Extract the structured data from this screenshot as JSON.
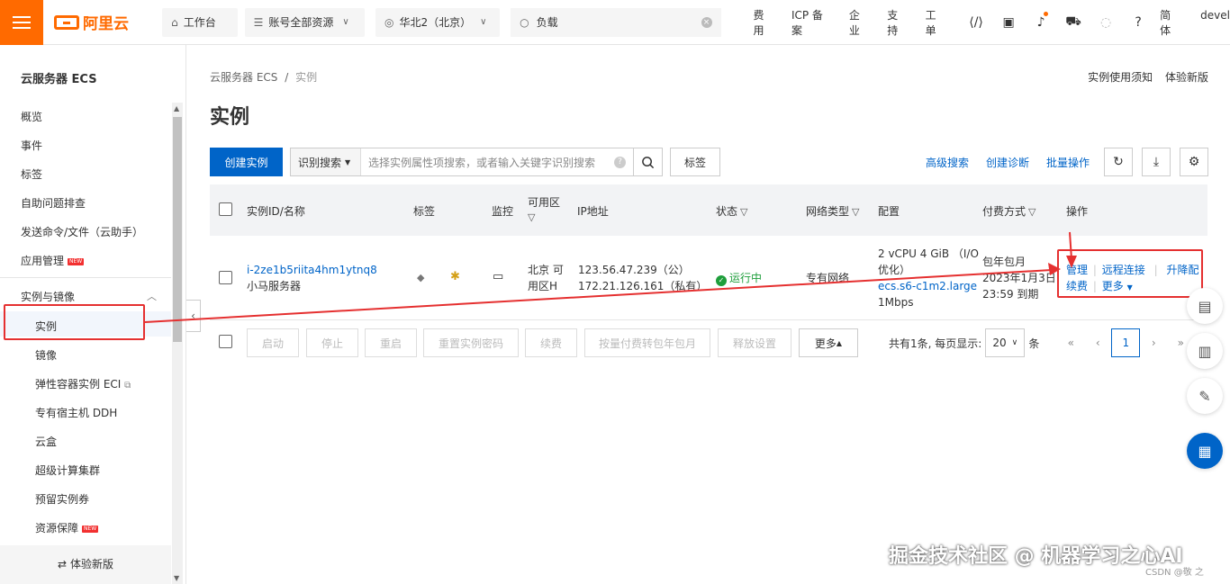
{
  "topbar": {
    "brand": "阿里云",
    "workbench": "工作台",
    "resource_group": "账号全部资源",
    "region": "华北2（北京）",
    "search_value": "负载",
    "links": [
      "费用",
      "ICP 备案",
      "企业",
      "支持",
      "工单"
    ],
    "lang": "简体",
    "user": "devel"
  },
  "sidebar": {
    "title": "云服务器 ECS",
    "items": [
      {
        "label": "概览"
      },
      {
        "label": "事件"
      },
      {
        "label": "标签"
      },
      {
        "label": "自助问题排查"
      },
      {
        "label": "发送命令/文件（云助手）"
      },
      {
        "label": "应用管理",
        "badge": "NEW"
      }
    ],
    "group": "实例与镜像",
    "sub_items": [
      {
        "label": "实例"
      },
      {
        "label": "镜像"
      },
      {
        "label": "弹性容器实例 ECI"
      },
      {
        "label": "专有宿主机 DDH"
      },
      {
        "label": "云盒"
      },
      {
        "label": "超级计算集群"
      },
      {
        "label": "预留实例券"
      },
      {
        "label": "资源保障",
        "badge": "NEW"
      }
    ],
    "footer": "体验新版"
  },
  "breadcrumb": {
    "root": "云服务器 ECS",
    "sep": "/",
    "current": "实例"
  },
  "top_right_links": [
    "实例使用须知",
    "体验新版"
  ],
  "page_title": "实例",
  "toolbar": {
    "create": "创建实例",
    "search_mode": "识别搜索",
    "search_placeholder": "选择实例属性项搜索，或者输入关键字识别搜索",
    "tag": "标签",
    "links": [
      "高级搜索",
      "创建诊断",
      "批量操作"
    ]
  },
  "table": {
    "headers": {
      "id": "实例ID/名称",
      "tag": "标签",
      "monitor": "监控",
      "zone": "可用区",
      "ip": "IP地址",
      "status": "状态",
      "network": "网络类型",
      "config": "配置",
      "billing": "付费方式",
      "action": "操作"
    },
    "row": {
      "id": "i-2ze1b5riita4hm1ytnq8",
      "name": "小马服务器",
      "zone_line1": "北京 可",
      "zone_line2": "用区H",
      "ip_public": "123.56.47.239（公）",
      "ip_private": "172.21.126.161（私有）",
      "status": "运行中",
      "network": "专有网络",
      "config_line1": "2 vCPU 4 GiB （I/O",
      "config_line2": "优化）",
      "config_type": "ecs.s6-c1m2.large",
      "config_bw": "1Mbps",
      "billing_line1": "包年包月",
      "billing_line2": "2023年1月3日",
      "billing_line3": "23:59 到期",
      "actions": {
        "manage": "管理",
        "remote": "远程连接",
        "upgrade": "升降配",
        "renew": "续费",
        "more": "更多"
      }
    }
  },
  "batch": {
    "buttons": [
      "启动",
      "停止",
      "重启",
      "重置实例密码",
      "续费",
      "按量付费转包年包月",
      "释放设置"
    ],
    "more": "更多",
    "summary": "共有1条, 每页显示:",
    "page_size": "20",
    "unit": "条",
    "current_page": "1"
  },
  "watermark": "掘金技术社区 @ 机器学习之心AI",
  "watermark_small": "CSDN @敬 之",
  "colors": {
    "brand": "#ff6a00",
    "primary": "#0064c8",
    "annotation": "#e53030",
    "running": "#1e9e3b"
  }
}
